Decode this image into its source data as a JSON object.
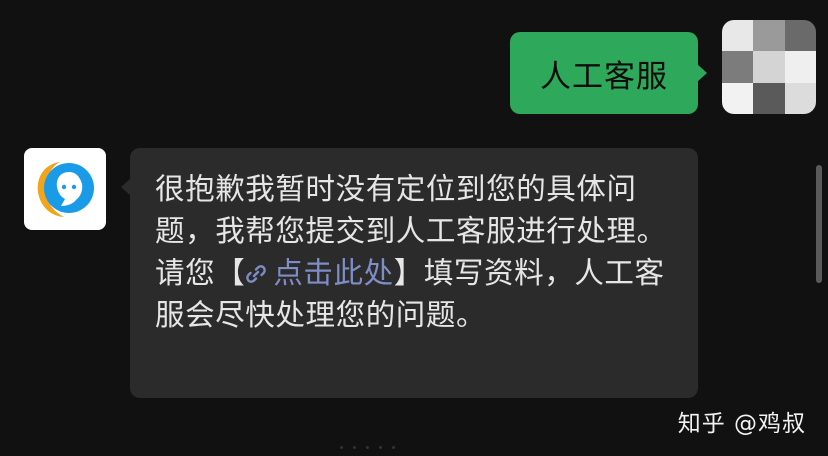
{
  "outgoing": {
    "text": "人工客服",
    "bubble_color": "#2ea85a"
  },
  "incoming": {
    "text_before_link": "很抱歉我暂时没有定位到您的具体问题，我帮您提交到人工客服进行处理。请您【",
    "link_text": "点击此处",
    "text_after_link": "】填写资料，人工客服会尽快处理您的问题。",
    "bubble_color": "#2b2b2b",
    "link_color": "#7f8dc6",
    "link_icon": "link-icon"
  },
  "bot_avatar": {
    "icon": "customer-service-icon"
  },
  "user_avatar": {
    "style": "pixelated"
  },
  "watermark": {
    "text": "知乎 @鸡叔"
  }
}
